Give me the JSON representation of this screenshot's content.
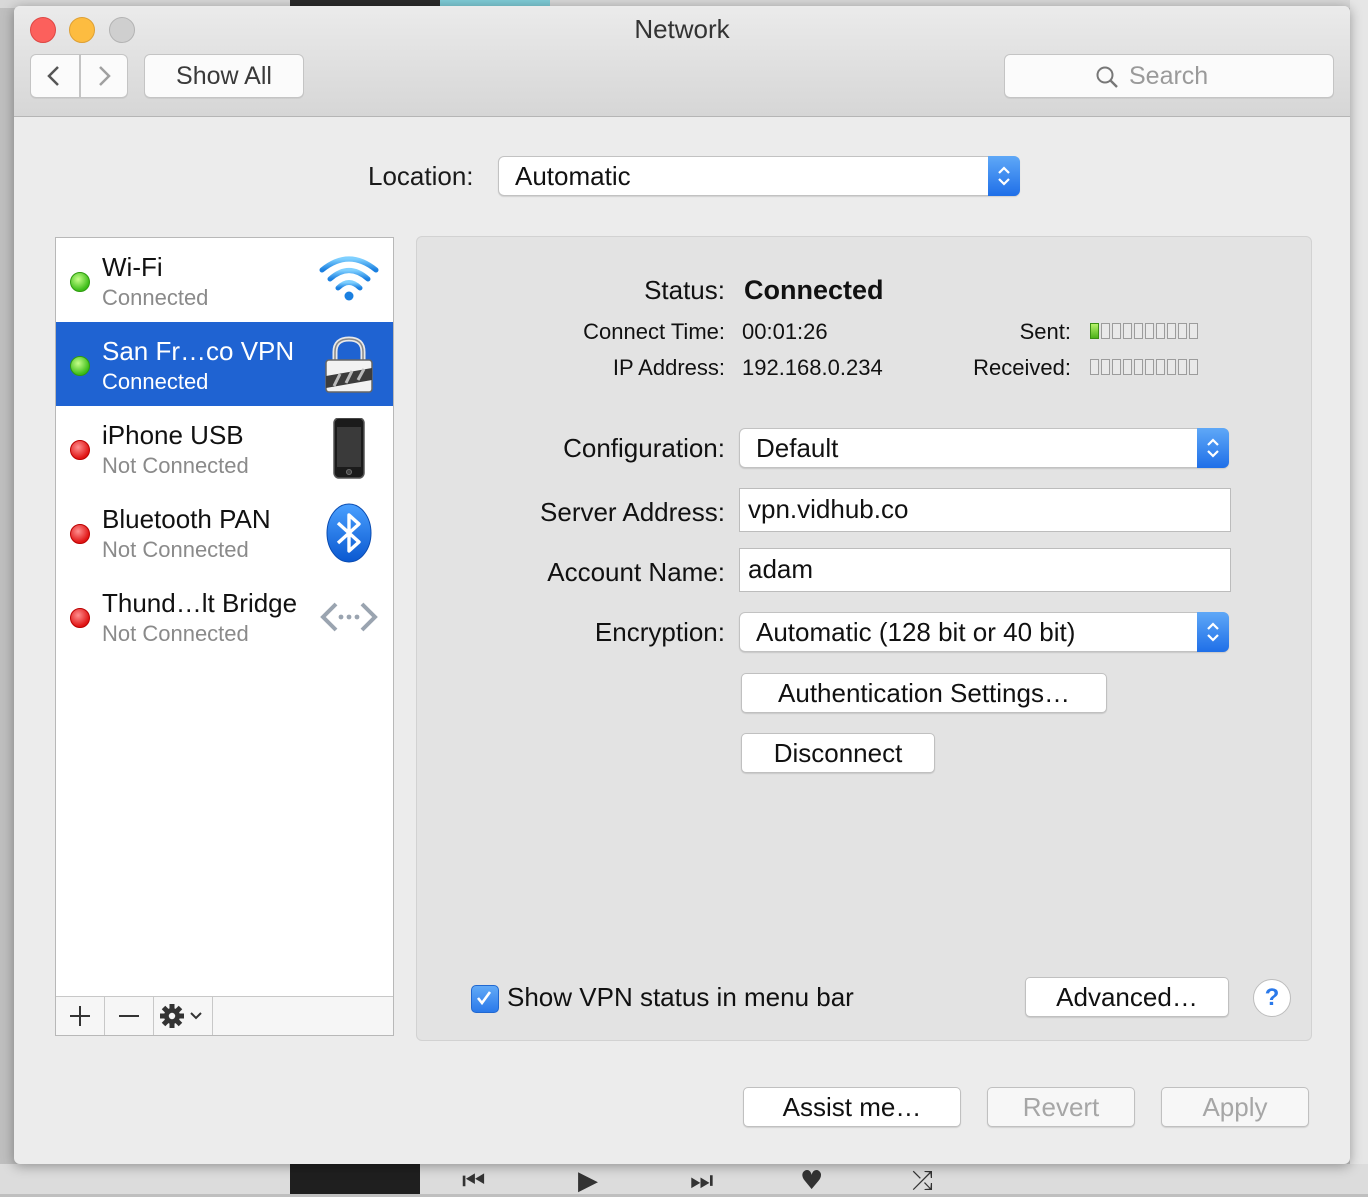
{
  "window": {
    "title": "Network"
  },
  "toolbar": {
    "show_all_label": "Show All",
    "search_placeholder": "Search"
  },
  "location": {
    "label": "Location:",
    "value": "Automatic"
  },
  "services": [
    {
      "name": "Wi-Fi",
      "status": "Connected",
      "state": "green",
      "icon": "wifi-icon",
      "selected": false
    },
    {
      "name": "San Fr…co VPN",
      "status": "Connected",
      "state": "green",
      "icon": "lock-icon",
      "selected": true
    },
    {
      "name": "iPhone USB",
      "status": "Not Connected",
      "state": "red",
      "icon": "iphone-icon",
      "selected": false
    },
    {
      "name": "Bluetooth PAN",
      "status": "Not Connected",
      "state": "red",
      "icon": "bluetooth-icon",
      "selected": false
    },
    {
      "name": "Thund…lt Bridge",
      "status": "Not Connected",
      "state": "red",
      "icon": "thunderbolt-bridge-icon",
      "selected": false
    }
  ],
  "sidebar_footer": {
    "add_label": "+",
    "remove_label": "−"
  },
  "detail": {
    "status_label": "Status:",
    "status_value": "Connected",
    "connect_time_label": "Connect Time:",
    "connect_time_value": "00:01:26",
    "ip_label": "IP Address:",
    "ip_value": "192.168.0.234",
    "sent_label": "Sent:",
    "sent_level": 1,
    "received_label": "Received:",
    "received_level": 0,
    "meter_segments": 10,
    "configuration_label": "Configuration:",
    "configuration_value": "Default",
    "server_label": "Server Address:",
    "server_value": "vpn.vidhub.co",
    "account_label": "Account Name:",
    "account_value": "adam",
    "encryption_label": "Encryption:",
    "encryption_value": "Automatic (128 bit or 40 bit)",
    "auth_button": "Authentication Settings…",
    "disconnect_button": "Disconnect",
    "show_status_label": "Show VPN status in menu bar",
    "show_status_checked": true,
    "advanced_button": "Advanced…",
    "help_label": "?"
  },
  "footer": {
    "assist_button": "Assist me…",
    "revert_button": "Revert",
    "apply_button": "Apply"
  },
  "colors": {
    "selection": "#1f63d2",
    "accent": "#2a79ea",
    "connected": "#3cbd18",
    "disconnected": "#e01414"
  }
}
